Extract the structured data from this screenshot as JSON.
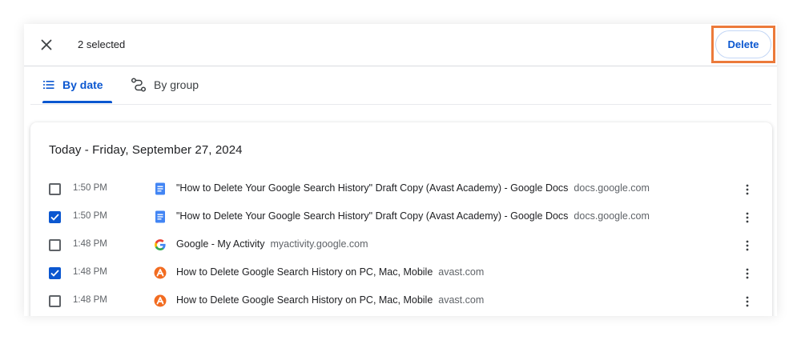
{
  "header": {
    "selected_count": "2 selected",
    "close_icon": "close-icon",
    "delete_label": "Delete"
  },
  "tabs": [
    {
      "label": "By date",
      "icon": "list-icon",
      "active": true
    },
    {
      "label": "By group",
      "icon": "group-route-icon",
      "active": false
    }
  ],
  "section": {
    "title": "Today - Friday, September 27, 2024"
  },
  "entries": [
    {
      "checked": false,
      "time": "1:50 PM",
      "favicon": "google-docs-icon",
      "title": "\"How to Delete Your Google Search History\" Draft Copy (Avast Academy) - Google Docs",
      "domain": "docs.google.com"
    },
    {
      "checked": true,
      "time": "1:50 PM",
      "favicon": "google-docs-icon",
      "title": "\"How to Delete Your Google Search History\" Draft Copy (Avast Academy) - Google Docs",
      "domain": "docs.google.com"
    },
    {
      "checked": false,
      "time": "1:48 PM",
      "favicon": "google-icon",
      "title": "Google - My Activity",
      "domain": "myactivity.google.com"
    },
    {
      "checked": true,
      "time": "1:48 PM",
      "favicon": "avast-icon",
      "title": "How to Delete Google Search History on PC, Mac, Mobile",
      "domain": "avast.com"
    },
    {
      "checked": false,
      "time": "1:48 PM",
      "favicon": "avast-icon",
      "title": "How to Delete Google Search History on PC, Mac, Mobile",
      "domain": "avast.com"
    }
  ],
  "colors": {
    "accent": "#0b57d0",
    "highlight": "#ec7a3a",
    "docs_blue": "#4285f4",
    "avast_orange": "#f26c21"
  }
}
